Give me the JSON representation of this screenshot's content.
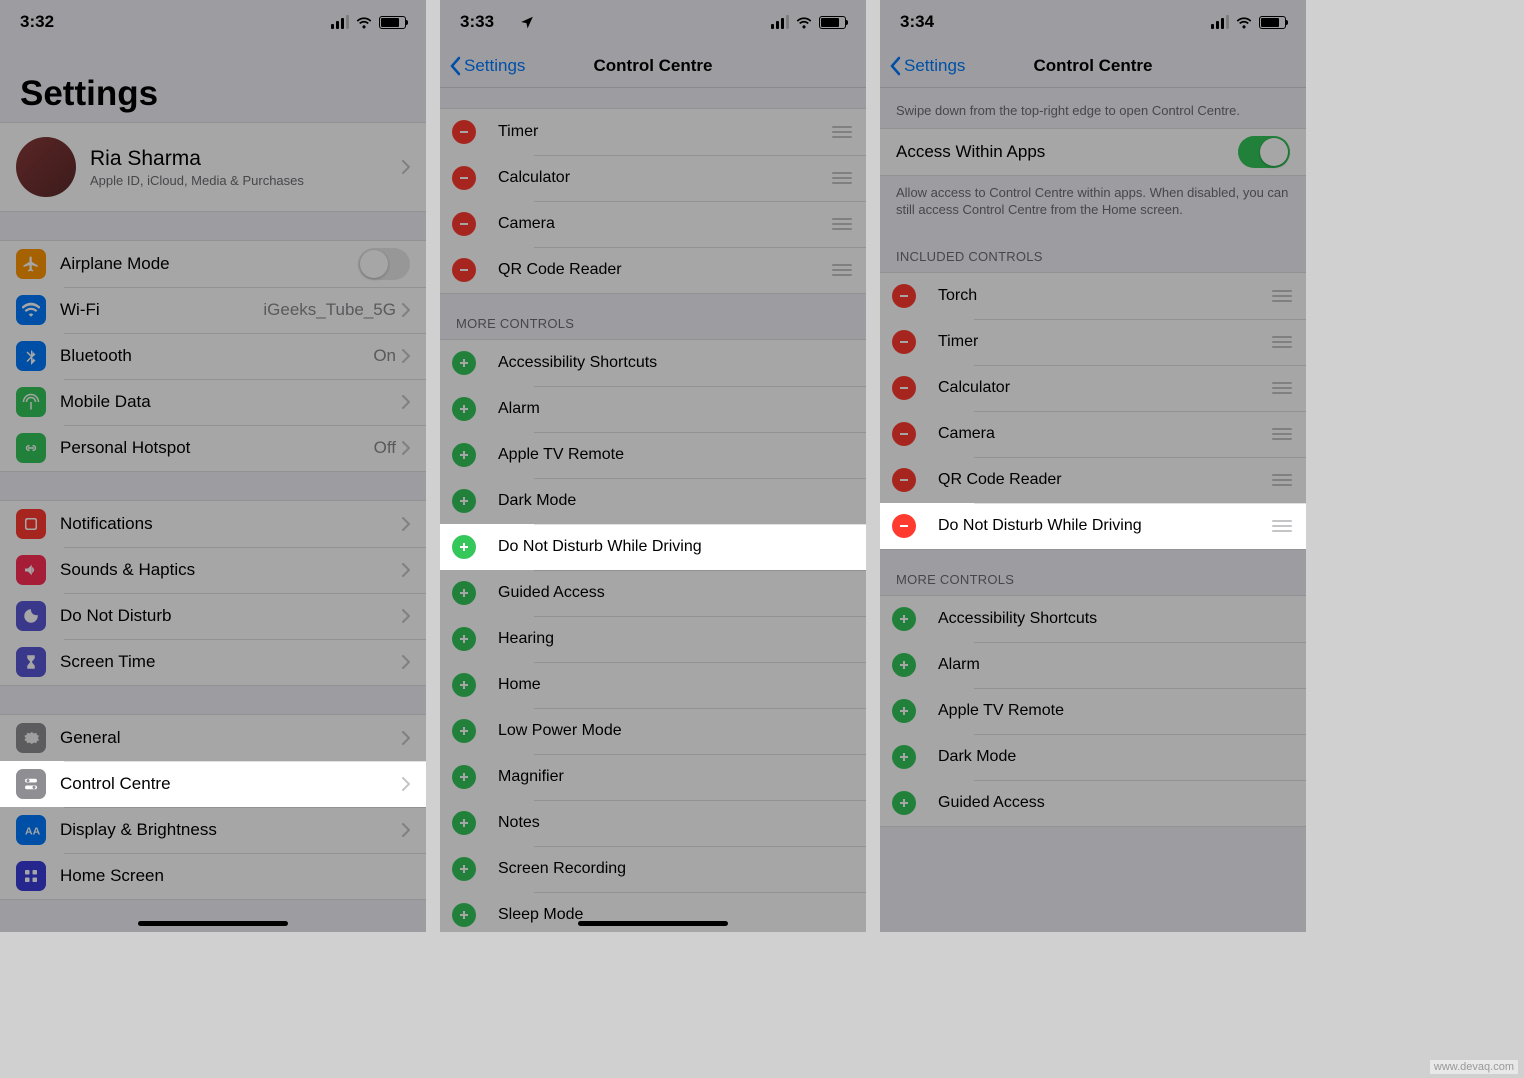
{
  "watermark": "www.devaq.com",
  "screens": {
    "s1": {
      "time": "3:32",
      "title": "Settings",
      "profile": {
        "name": "Ria Sharma",
        "sub": "Apple ID, iCloud, Media & Purchases"
      },
      "g1": [
        {
          "label": "Airplane Mode",
          "detail": "",
          "switch": "off"
        },
        {
          "label": "Wi-Fi",
          "detail": "iGeeks_Tube_5G"
        },
        {
          "label": "Bluetooth",
          "detail": "On"
        },
        {
          "label": "Mobile Data",
          "detail": ""
        },
        {
          "label": "Personal Hotspot",
          "detail": "Off"
        }
      ],
      "g2": [
        {
          "label": "Notifications"
        },
        {
          "label": "Sounds & Haptics"
        },
        {
          "label": "Do Not Disturb"
        },
        {
          "label": "Screen Time"
        }
      ],
      "g3": [
        {
          "label": "General"
        },
        {
          "label": "Control Centre"
        },
        {
          "label": "Display & Brightness"
        },
        {
          "label": "Home Screen"
        }
      ]
    },
    "s2": {
      "time": "3:33",
      "back": "Settings",
      "title": "Control Centre",
      "included": [
        {
          "label": "Timer"
        },
        {
          "label": "Calculator"
        },
        {
          "label": "Camera"
        },
        {
          "label": "QR Code Reader"
        }
      ],
      "more_header": "MORE CONTROLS",
      "more": [
        {
          "label": "Accessibility Shortcuts"
        },
        {
          "label": "Alarm"
        },
        {
          "label": "Apple TV Remote"
        },
        {
          "label": "Dark Mode"
        },
        {
          "label": "Do Not Disturb While Driving"
        },
        {
          "label": "Guided Access"
        },
        {
          "label": "Hearing"
        },
        {
          "label": "Home"
        },
        {
          "label": "Low Power Mode"
        },
        {
          "label": "Magnifier"
        },
        {
          "label": "Notes"
        },
        {
          "label": "Screen Recording"
        },
        {
          "label": "Sleep Mode"
        }
      ]
    },
    "s3": {
      "time": "3:34",
      "back": "Settings",
      "title": "Control Centre",
      "hint": "Swipe down from the top-right edge to open Control Centre.",
      "access_label": "Access Within Apps",
      "access_note": "Allow access to Control Centre within apps. When disabled, you can still access Control Centre from the Home screen.",
      "included_header": "INCLUDED CONTROLS",
      "included": [
        {
          "label": "Torch"
        },
        {
          "label": "Timer"
        },
        {
          "label": "Calculator"
        },
        {
          "label": "Camera"
        },
        {
          "label": "QR Code Reader"
        },
        {
          "label": "Do Not Disturb While Driving"
        }
      ],
      "more_header": "MORE CONTROLS",
      "more": [
        {
          "label": "Accessibility Shortcuts"
        },
        {
          "label": "Alarm"
        },
        {
          "label": "Apple TV Remote"
        },
        {
          "label": "Dark Mode"
        },
        {
          "label": "Guided Access"
        }
      ]
    }
  }
}
